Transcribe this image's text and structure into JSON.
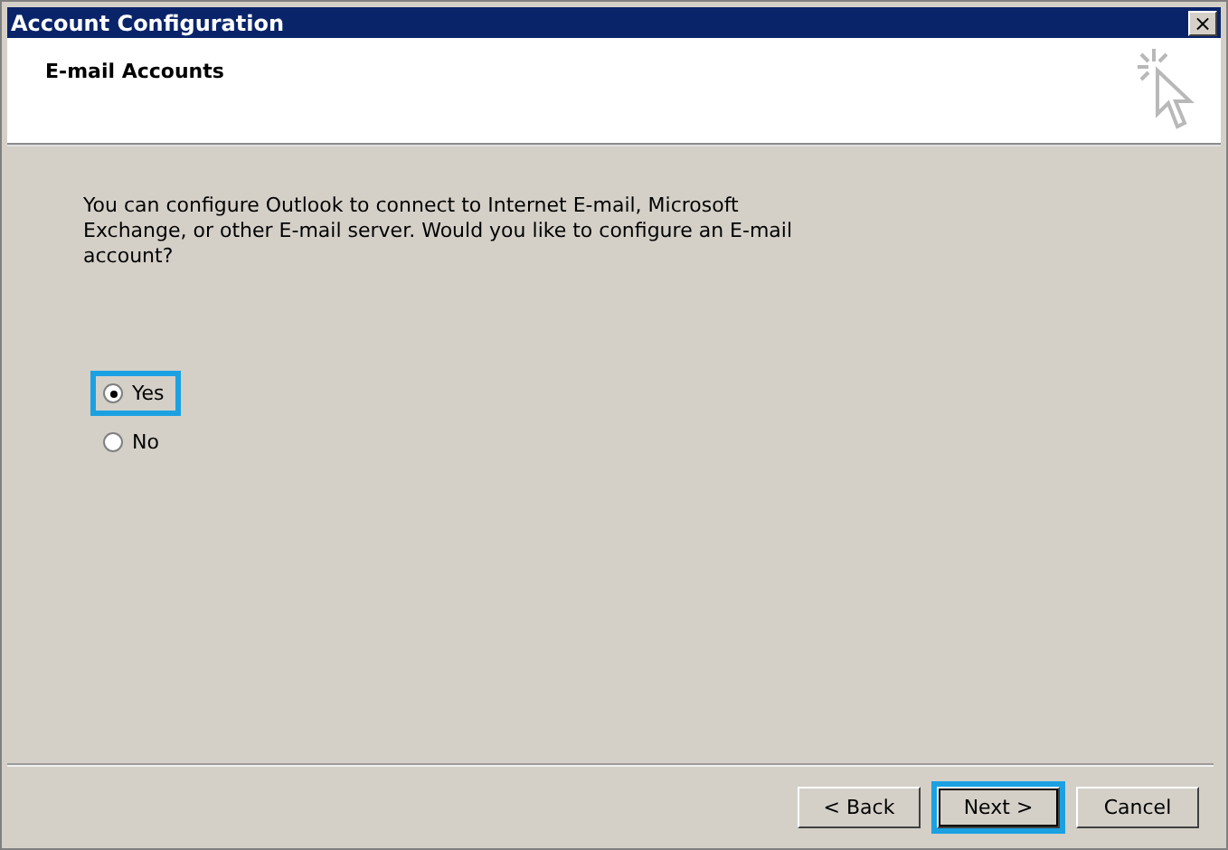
{
  "window": {
    "title": "Account Configuration",
    "close": "×"
  },
  "header": {
    "title": "E-mail Accounts"
  },
  "message": "You can configure Outlook to connect to Internet E-mail, Microsoft Exchange, or other E-mail server. Would you like to configure an E-mail account?",
  "options": [
    {
      "label": "Yes",
      "selected": true,
      "highlighted": true
    },
    {
      "label": "No",
      "selected": false,
      "highlighted": false
    }
  ],
  "buttons": [
    {
      "label": "< Back",
      "default": false,
      "highlighted": false
    },
    {
      "label": "Next >",
      "default": true,
      "highlighted": true
    },
    {
      "label": "Cancel",
      "default": false,
      "highlighted": false
    }
  ]
}
